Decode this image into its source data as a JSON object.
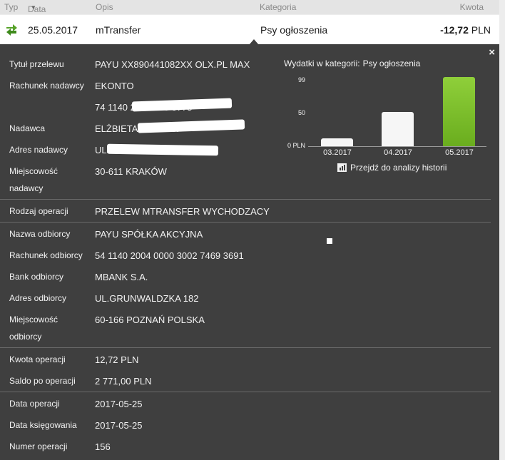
{
  "header": {
    "typ": "Typ",
    "data": "Data",
    "opis": "Opis",
    "kategoria": "Kategoria",
    "kwota": "Kwota"
  },
  "transaction": {
    "date": "25.05.2017",
    "description": "mTransfer",
    "category": "Psy ogłoszenia",
    "amount": "-12,72",
    "currency": "PLN",
    "icon": "transfer-arrows-icon"
  },
  "details": {
    "close": "×",
    "rows": [
      {
        "label": "Tytuł przelewu",
        "value": "PAYU XX890441082XX OLX.PL MAX"
      },
      {
        "label": "Rachunek nadawcy",
        "value": "EKONTO"
      },
      {
        "label": "",
        "value": "74 1140 2004 000            3778"
      },
      {
        "label": "Nadawca",
        "value": "ELŻBIETA MARIA W"
      },
      {
        "label": "Adres nadawcy",
        "value": "UL."
      },
      {
        "label": "Miejscowość",
        "label2": "nadawcy",
        "value": "30-611 KRAKÓW"
      },
      {
        "label": "Rodzaj operacji",
        "value": "PRZELEW MTRANSFER WYCHODZACY"
      },
      {
        "label": "Nazwa odbiorcy",
        "value": "PAYU SPÓŁKA AKCYJNA"
      },
      {
        "label": "Rachunek odbiorcy",
        "value": "54 1140 2004 0000 3002 7469 3691"
      },
      {
        "label": "Bank odbiorcy",
        "value": "MBANK S.A."
      },
      {
        "label": "Adres odbiorcy",
        "value": "UL.GRUNWALDZKA 182"
      },
      {
        "label": "Miejscowość",
        "label2": "odbiorcy",
        "value": "60-166 POZNAŃ POLSKA"
      },
      {
        "label": "Kwota operacji",
        "value": "12,72 PLN"
      },
      {
        "label": "Saldo po operacji",
        "value": "2 771,00 PLN"
      },
      {
        "label": "Data operacji",
        "value": "2017-05-25"
      },
      {
        "label": "Data księgowania",
        "value": "2017-05-25"
      },
      {
        "label": "Numer operacji",
        "value": "156"
      }
    ]
  },
  "chart": {
    "title": "Wydatki w kategorii:",
    "category": "Psy ogłoszenia",
    "history_link": "Przejdź do analizy historii",
    "colors": {
      "normal": "#f6f6f6",
      "current": "#6aad1e"
    },
    "chart_data": {
      "type": "bar",
      "categories": [
        "03.2017",
        "04.2017",
        "05.2017"
      ],
      "values": [
        12,
        52,
        104
      ],
      "ytick_labels": [
        "99",
        "50",
        "0 PLN"
      ],
      "ytick_values": [
        99,
        50,
        0
      ],
      "ylim": [
        0,
        125
      ],
      "highlight_index": 2
    }
  }
}
